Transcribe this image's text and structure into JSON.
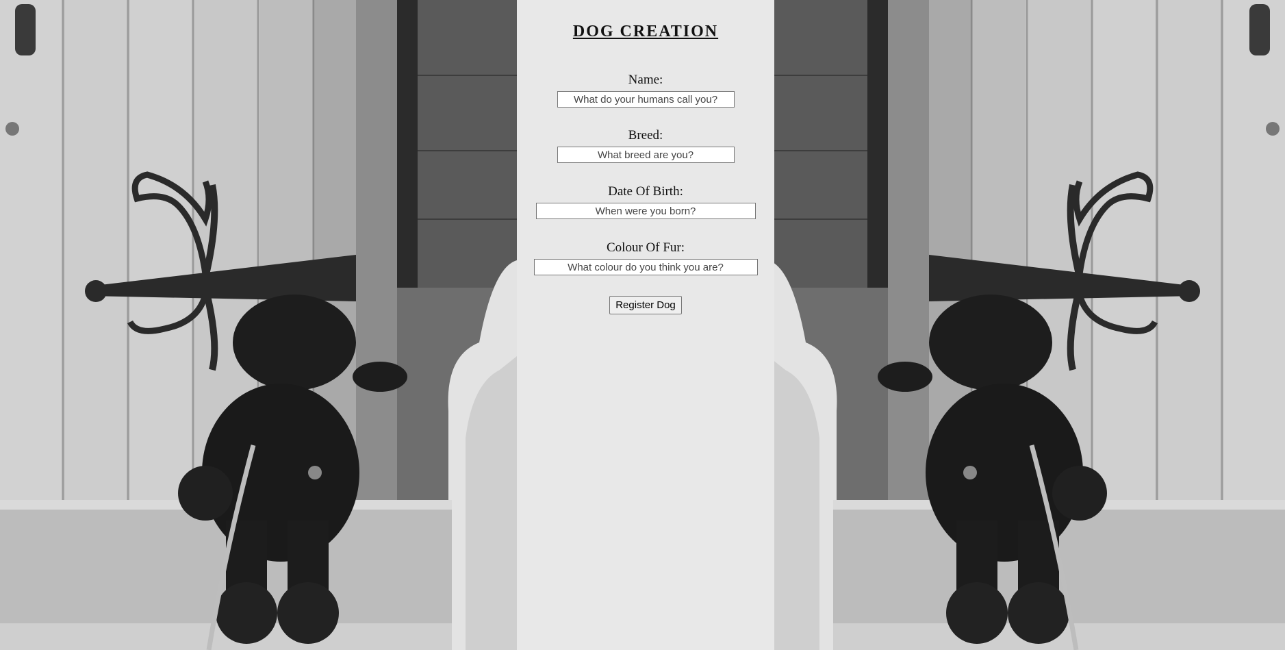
{
  "form": {
    "title": "DOG CREATION",
    "fields": [
      {
        "label": "Name:",
        "placeholder": "What do your humans call you?"
      },
      {
        "label": "Breed:",
        "placeholder": "What breed are you?"
      },
      {
        "label": "Date Of Birth:",
        "placeholder": "When were you born?"
      },
      {
        "label": "Colour Of Fur:",
        "placeholder": "What colour do you think you are?"
      }
    ],
    "submit_label": "Register Dog"
  },
  "colors": {
    "panel_background": "#e8e8e8",
    "photo_tone": "grayscale"
  }
}
